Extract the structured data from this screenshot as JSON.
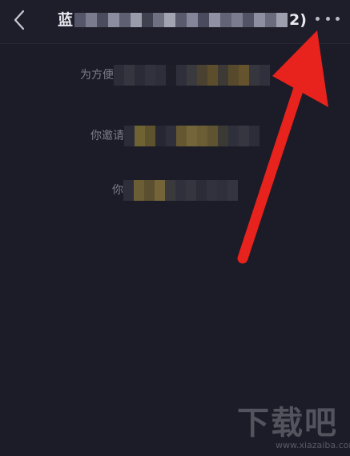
{
  "header": {
    "title_start": "蓝",
    "title_end": "2)",
    "back_icon": "chevron-left-icon",
    "more_icon": "more-horizontal-icon"
  },
  "messages": [
    {
      "prefix": "为方便",
      "suffix": ""
    },
    {
      "prefix": "你邀请",
      "suffix": ""
    },
    {
      "prefix": "你",
      "suffix": ""
    }
  ],
  "watermark": {
    "text": "下载吧",
    "url": "www.xiazaiba.com"
  },
  "colors": {
    "background": "#1b1c27",
    "header_text": "#e8e8ee",
    "system_text": "#7c7e8c",
    "arrow": "#e8221c",
    "mosaic_gold": "#7a6a30"
  }
}
